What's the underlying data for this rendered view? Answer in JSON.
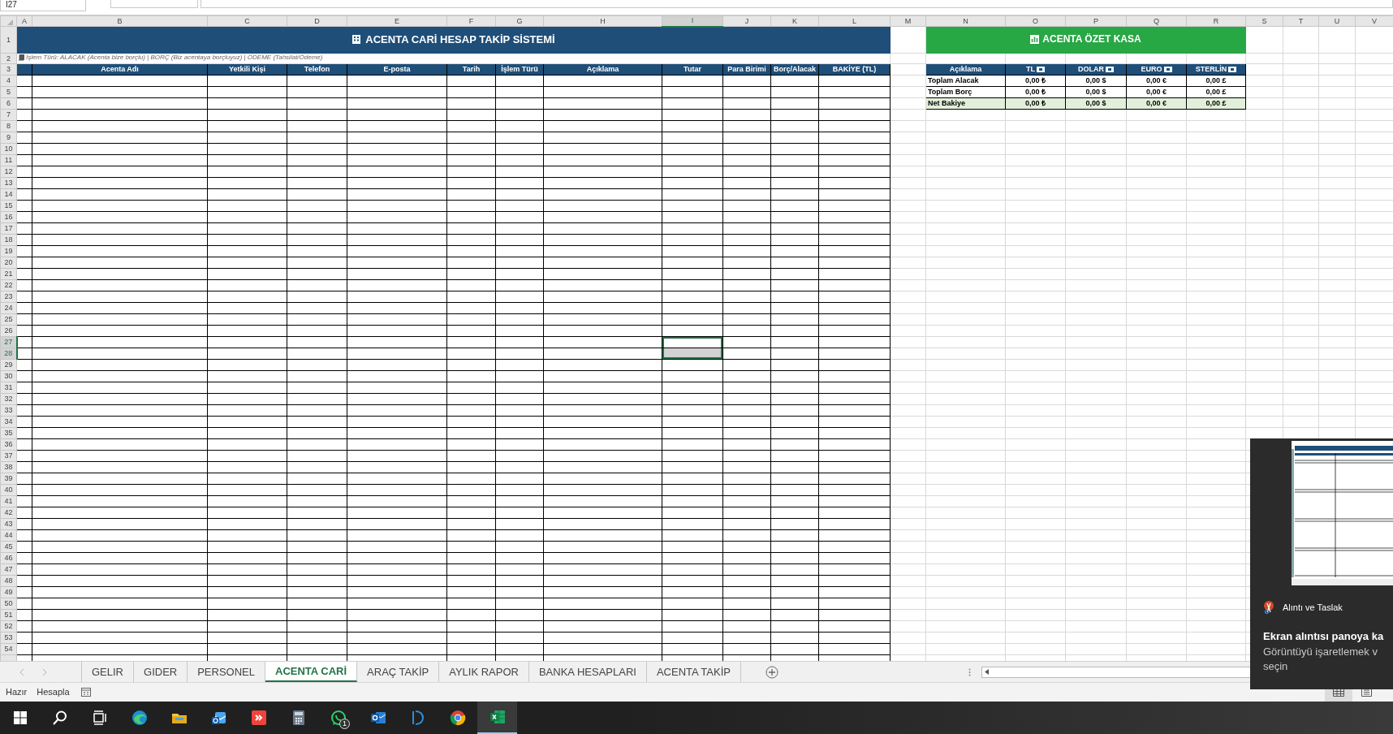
{
  "name_box": "I27",
  "column_headers": [
    {
      "label": "A",
      "selected": false
    },
    {
      "label": "B",
      "selected": false
    },
    {
      "label": "C",
      "selected": false
    },
    {
      "label": "D",
      "selected": false
    },
    {
      "label": "E",
      "selected": false
    },
    {
      "label": "F",
      "selected": false
    },
    {
      "label": "G",
      "selected": false
    },
    {
      "label": "H",
      "selected": false
    },
    {
      "label": "I",
      "selected": true
    },
    {
      "label": "J",
      "selected": false
    },
    {
      "label": "K",
      "selected": false
    },
    {
      "label": "L",
      "selected": false
    },
    {
      "label": "M",
      "selected": false
    },
    {
      "label": "N",
      "selected": false
    },
    {
      "label": "O",
      "selected": false
    },
    {
      "label": "P",
      "selected": false
    },
    {
      "label": "Q",
      "selected": false
    },
    {
      "label": "R",
      "selected": false
    },
    {
      "label": "S",
      "selected": false
    },
    {
      "label": "T",
      "selected": false
    },
    {
      "label": "U",
      "selected": false
    },
    {
      "label": "V",
      "selected": false
    }
  ],
  "row_headers": [
    {
      "label": "1",
      "selected": false
    },
    {
      "label": "2",
      "selected": false
    },
    {
      "label": "3",
      "selected": false
    },
    {
      "label": "4",
      "selected": false
    },
    {
      "label": "5",
      "selected": false
    },
    {
      "label": "6",
      "selected": false
    },
    {
      "label": "7",
      "selected": false
    },
    {
      "label": "8",
      "selected": false
    },
    {
      "label": "9",
      "selected": false
    },
    {
      "label": "10",
      "selected": false
    },
    {
      "label": "11",
      "selected": false
    },
    {
      "label": "12",
      "selected": false
    },
    {
      "label": "13",
      "selected": false
    },
    {
      "label": "14",
      "selected": false
    },
    {
      "label": "15",
      "selected": false
    },
    {
      "label": "16",
      "selected": false
    },
    {
      "label": "17",
      "selected": false
    },
    {
      "label": "18",
      "selected": false
    },
    {
      "label": "19",
      "selected": false
    },
    {
      "label": "20",
      "selected": false
    },
    {
      "label": "21",
      "selected": false
    },
    {
      "label": "22",
      "selected": false
    },
    {
      "label": "23",
      "selected": false
    },
    {
      "label": "24",
      "selected": false
    },
    {
      "label": "25",
      "selected": false
    },
    {
      "label": "26",
      "selected": false
    },
    {
      "label": "27",
      "selected": true
    },
    {
      "label": "28",
      "selected": true
    },
    {
      "label": "29",
      "selected": false
    },
    {
      "label": "30",
      "selected": false
    },
    {
      "label": "31",
      "selected": false
    },
    {
      "label": "32",
      "selected": false
    },
    {
      "label": "33",
      "selected": false
    },
    {
      "label": "34",
      "selected": false
    },
    {
      "label": "35",
      "selected": false
    },
    {
      "label": "36",
      "selected": false
    },
    {
      "label": "37",
      "selected": false
    },
    {
      "label": "38",
      "selected": false
    },
    {
      "label": "39",
      "selected": false
    },
    {
      "label": "40",
      "selected": false
    },
    {
      "label": "41",
      "selected": false
    },
    {
      "label": "42",
      "selected": false
    },
    {
      "label": "43",
      "selected": false
    },
    {
      "label": "44",
      "selected": false
    },
    {
      "label": "45",
      "selected": false
    },
    {
      "label": "46",
      "selected": false
    },
    {
      "label": "47",
      "selected": false
    },
    {
      "label": "48",
      "selected": false
    },
    {
      "label": "49",
      "selected": false
    },
    {
      "label": "50",
      "selected": false
    },
    {
      "label": "51",
      "selected": false
    },
    {
      "label": "52",
      "selected": false
    },
    {
      "label": "53",
      "selected": false
    },
    {
      "label": "54",
      "selected": false
    }
  ],
  "title": "ACENTA CARİ HESAP TAKİP SİSTEMİ",
  "note": "İşlem Türü: ALACAK (Acenta bize borçlu) | BORÇ (Biz acentaya borçluyuz) | ÖDEME (Tahsilat/Ödeme)",
  "table": {
    "columns": [
      "Acenta Adı",
      "Yetkili Kişi",
      "Telefon",
      "E-posta",
      "Tarih",
      "İşlem Türü",
      "Açıklama",
      "Tutar",
      "Para Birimi",
      "Borç/Alacak",
      "BAKİYE (TL)"
    ]
  },
  "summary": {
    "title": "ACENTA ÖZET KASA",
    "columns": [
      {
        "label": "Açıklama",
        "flag": false
      },
      {
        "label": "TL",
        "flag": true
      },
      {
        "label": "DOLAR",
        "flag": true
      },
      {
        "label": "EURO",
        "flag": true
      },
      {
        "label": "STERLİN",
        "flag": true
      }
    ],
    "rows": [
      {
        "label": "Toplam Alacak",
        "highlight": false,
        "values": [
          "0,00 ₺",
          "0,00 $",
          "0,00 €",
          "0,00 £"
        ]
      },
      {
        "label": "Toplam Borç",
        "highlight": false,
        "values": [
          "0,00 ₺",
          "0,00 $",
          "0,00 €",
          "0,00 £"
        ]
      },
      {
        "label": "Net Bakiye",
        "highlight": true,
        "values": [
          "0,00 ₺",
          "0,00 $",
          "0,00 €",
          "0,00 £"
        ]
      }
    ]
  },
  "sheet_tabs": [
    {
      "label": "GELIR",
      "selected": false
    },
    {
      "label": "GIDER",
      "selected": false
    },
    {
      "label": "PERSONEL",
      "selected": false
    },
    {
      "label": "ACENTA CARİ",
      "selected": true
    },
    {
      "label": "ARAÇ TAKİP",
      "selected": false
    },
    {
      "label": "AYLIK RAPOR",
      "selected": false
    },
    {
      "label": "BANKA HESAPLARI",
      "selected": false
    },
    {
      "label": "ACENTA TAKİP",
      "selected": false
    }
  ],
  "status_bar": [
    "Hazır",
    "Hesapla"
  ],
  "taskbar": [
    {
      "kind": "start",
      "active": false
    },
    {
      "kind": "search",
      "active": false
    },
    {
      "kind": "taskview",
      "active": false
    },
    {
      "kind": "edge",
      "active": false
    },
    {
      "kind": "explorer",
      "active": false
    },
    {
      "kind": "mail",
      "active": false
    },
    {
      "kind": "remote",
      "active": false
    },
    {
      "kind": "calculator",
      "active": false
    },
    {
      "kind": "whatsapp",
      "active": false,
      "badge": "1"
    },
    {
      "kind": "outlook",
      "active": false
    },
    {
      "kind": "dapp",
      "active": false
    },
    {
      "kind": "chrome",
      "active": false
    },
    {
      "kind": "excel",
      "active": true
    }
  ],
  "notification": {
    "app": "Alıntı ve Taslak",
    "title": "Ekran alıntısı panoya ka",
    "lines": [
      "Görüntüyü işaretlemek v",
      "seçin"
    ]
  }
}
